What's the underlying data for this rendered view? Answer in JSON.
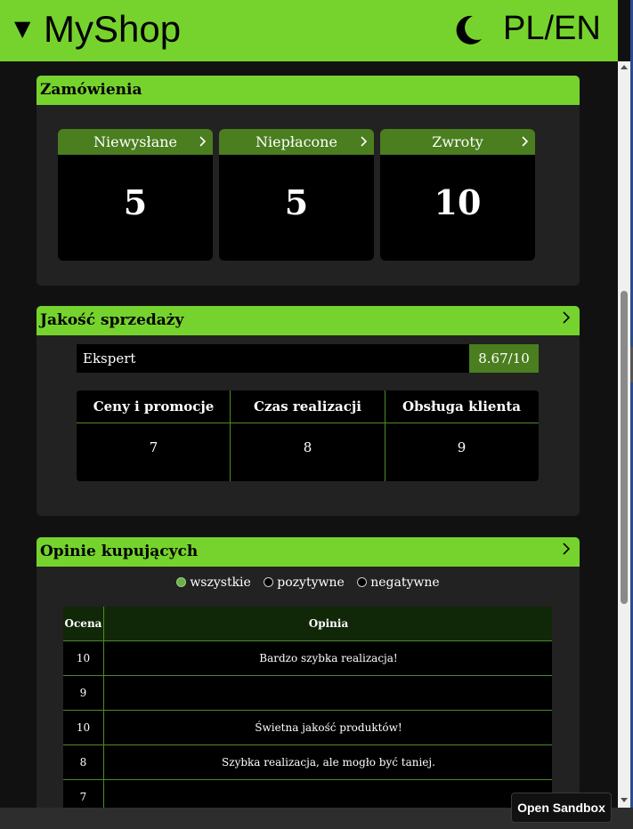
{
  "header": {
    "brand": "MyShop",
    "caret": "▼",
    "lang": "PL/EN",
    "accent": "#76d32e"
  },
  "orders": {
    "title": "Zamówienia",
    "cards": [
      {
        "label": "Niewysłane",
        "value": "5"
      },
      {
        "label": "Niepłacone",
        "value": "5"
      },
      {
        "label": "Zwroty",
        "value": "10"
      }
    ]
  },
  "quality": {
    "title": "Jakość sprzedaży",
    "level": "Ekspert",
    "score": "8.67/10",
    "columns": [
      {
        "label": "Ceny i promocje",
        "value": "7"
      },
      {
        "label": "Czas realizacji",
        "value": "8"
      },
      {
        "label": "Obsługa klienta",
        "value": "9"
      }
    ]
  },
  "reviews": {
    "title": "Opinie kupujących",
    "filters": [
      {
        "label": "wszystkie",
        "checked": true
      },
      {
        "label": "pozytywne",
        "checked": false
      },
      {
        "label": "negatywne",
        "checked": false
      }
    ],
    "headers": {
      "rating": "Ocena",
      "opinion": "Opinia"
    },
    "rows": [
      {
        "rating": "10",
        "opinion": "Bardzo szybka realizacja!"
      },
      {
        "rating": "9",
        "opinion": ""
      },
      {
        "rating": "10",
        "opinion": "Świetna jakość produktów!"
      },
      {
        "rating": "8",
        "opinion": "Szybka realizacja, ale mogło być taniej."
      },
      {
        "rating": "7",
        "opinion": ""
      }
    ]
  },
  "sandbox": {
    "label": "Open Sandbox"
  }
}
